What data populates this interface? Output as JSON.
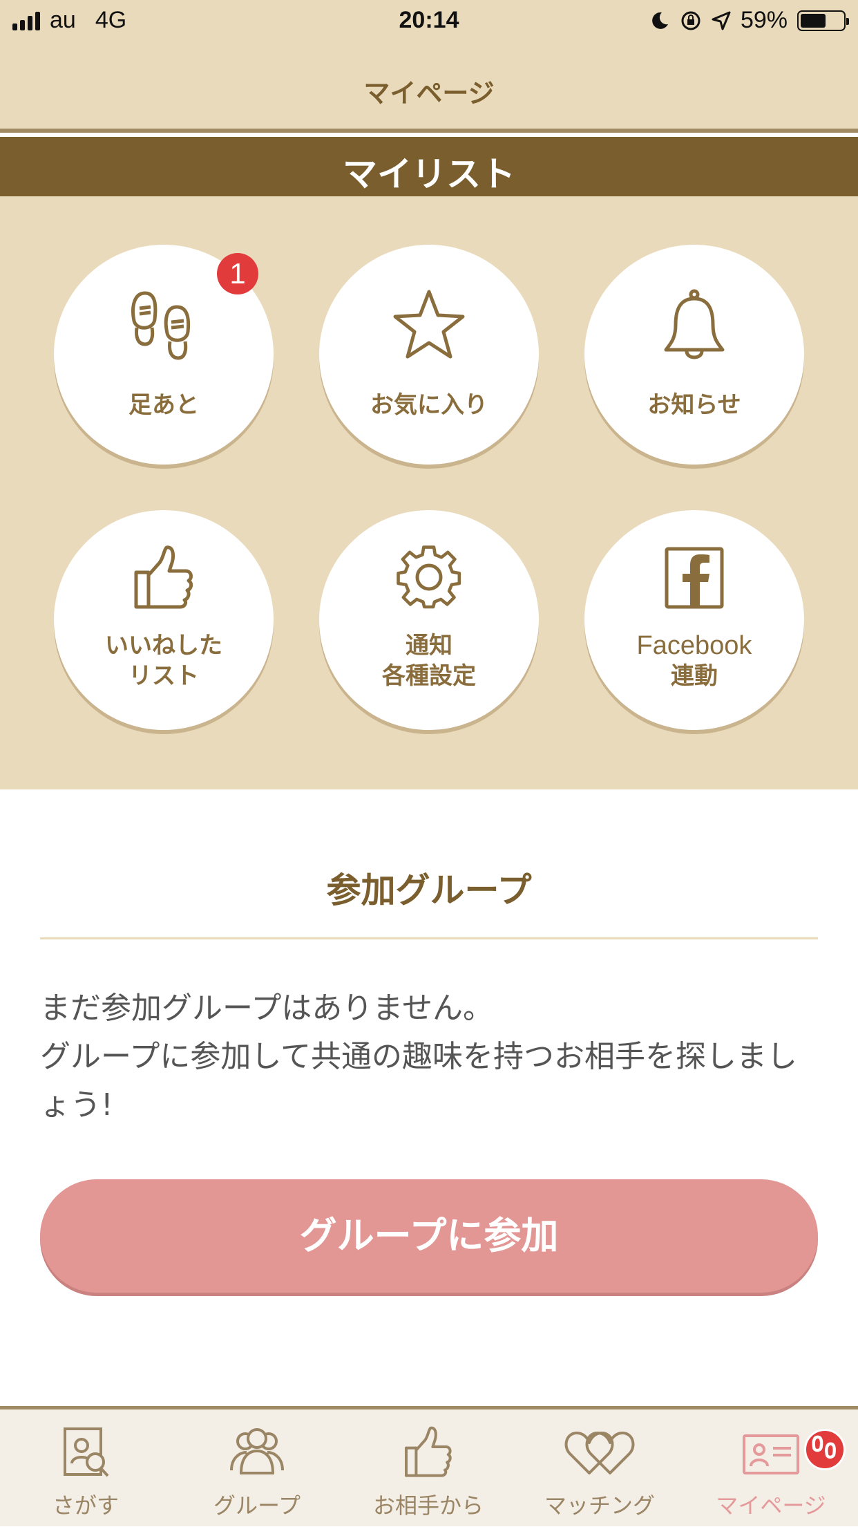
{
  "status_bar": {
    "carrier": "au",
    "network": "4G",
    "time": "20:14",
    "battery": "59%"
  },
  "nav": {
    "title": "マイページ"
  },
  "my_list": {
    "header": "マイリスト",
    "items": [
      {
        "label": "足あと",
        "icon": "footprints-icon",
        "badge": "1"
      },
      {
        "label": "お気に入り",
        "icon": "star-icon"
      },
      {
        "label": "お知らせ",
        "icon": "bell-icon"
      },
      {
        "label_line1": "いいねした",
        "label_line2": "リスト",
        "icon": "thumbs-up-icon"
      },
      {
        "label_line1": "通知",
        "label_line2": "各種設定",
        "icon": "gear-icon"
      },
      {
        "label_line1": "Facebook",
        "label_line2": "連動",
        "icon": "facebook-icon"
      }
    ]
  },
  "groups": {
    "title": "参加グループ",
    "empty_line1": "まだ参加グループはありません。",
    "empty_line2": "グループに参加して共通の趣味を持つお相手を探しましょう!",
    "join_button": "グループに参加"
  },
  "tabbar": {
    "tabs": [
      {
        "label": "さがす",
        "icon": "search-profile-icon"
      },
      {
        "label": "グループ",
        "icon": "group-icon"
      },
      {
        "label": "お相手から",
        "icon": "thumbs-up-icon"
      },
      {
        "label": "マッチング",
        "icon": "hearts-icon"
      },
      {
        "label": "マイページ",
        "icon": "profile-card-icon",
        "active": true
      }
    ]
  },
  "colors": {
    "beige": "#e9dabb",
    "brown": "#7b5e2d",
    "pink": "#e29795",
    "badge_red": "#e23b3b"
  }
}
